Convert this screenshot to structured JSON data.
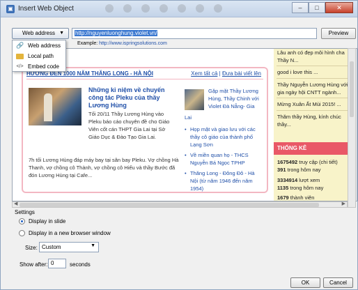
{
  "window": {
    "title": "Insert Web Object",
    "controls": {
      "minimize": "–",
      "maximize": "□",
      "close": "✕"
    }
  },
  "toolbar": {
    "address_button_label": "Web address",
    "url_value": "http://nguyenluonghung.violet.vn/",
    "preview_label": "Preview",
    "example_prefix": "Example:",
    "example_url": "http://www.ispringsolutions.com"
  },
  "dropdown_menu": {
    "items": [
      {
        "label": "Web address",
        "icon": "link-icon"
      },
      {
        "label": "Local path",
        "icon": "folder-icon"
      },
      {
        "label": "Embed code",
        "icon": "code-icon"
      }
    ]
  },
  "web_preview": {
    "section_title": "HƯỚNG ĐẾN 1000 NĂM THĂNG LONG - HÀ NỘI",
    "section_link_all": "Xem tất cả",
    "section_link_post": "Đưa bài viết lên",
    "main_article_title": "Những kỉ niệm về chuyến công tác Pleku của thầy Lương Hùng",
    "main_article_body": "Tối 20/11 Thầy Lương Hùng vào Pleku báo cáo chuyên đề cho Giáo Viên cốt cán THPT Gia Lai tại Sở Giáo Dục & Đào Tạo Gia Lai.",
    "main_article_body2": "7h tối Lương Hùng đáp máy bay tại sân bay Pleku. Vợ chồng Hà Thanh, vợ chồng cô Thành, vợ chồng cô Hiếu và thầy Bước đã đón Lương Hùng tại Cafe...",
    "side_article": "Gặp mặt Thầy Lương Hùng, Thầy Chinh với Violet Đà Nẵng- Gia",
    "side_label": "Lai",
    "side_links": [
      "Họp mặt và giao lưu với các thầy cô giáo của thành phố Lạng Sơn",
      "Về miền quan họ - THCS Nguyễn Bá Ngọc TPHP",
      "Thăng Long - Đông Đô - Hà Nội (từ năm 1946 đến năm 1954)"
    ],
    "right_messages": [
      "Lâu anh có đẹp môi hình cha",
      "Thầy N...",
      "good i love this ...",
      "Thầy Nguyễn Lương Hùng với gia ngày hội CNTT ngành...",
      "Mừng Xuân Ất Mùi 2015! ...",
      "Thăm thầy Hùng, kính chúc thầy..."
    ],
    "stats_title": "THỐNG KÊ",
    "stats": [
      {
        "num": "1675492",
        "text": "truy cập  (chi tiết)"
      },
      {
        "num": "391",
        "text": "trong hôm nay"
      },
      {
        "num": "3334914",
        "text": "lượt xem"
      },
      {
        "num": "1135",
        "text": "trong hôm nay"
      },
      {
        "num": "1679",
        "text": "thành viên"
      }
    ]
  },
  "settings": {
    "title": "Settings",
    "option_slide": "Display in slide",
    "option_window": "Display in a new browser window",
    "size_label": "Size:",
    "size_value": "Custom",
    "show_after_label": "Show after:",
    "show_after_value": "0",
    "seconds_label": "seconds"
  },
  "buttons": {
    "ok": "OK",
    "cancel": "Cancel"
  },
  "colors": {
    "accent_blue": "#1f4fa8",
    "pink_border": "#f3b7c2",
    "stats_header": "#e95867",
    "sidebar_bg": "#f8f3c9"
  }
}
